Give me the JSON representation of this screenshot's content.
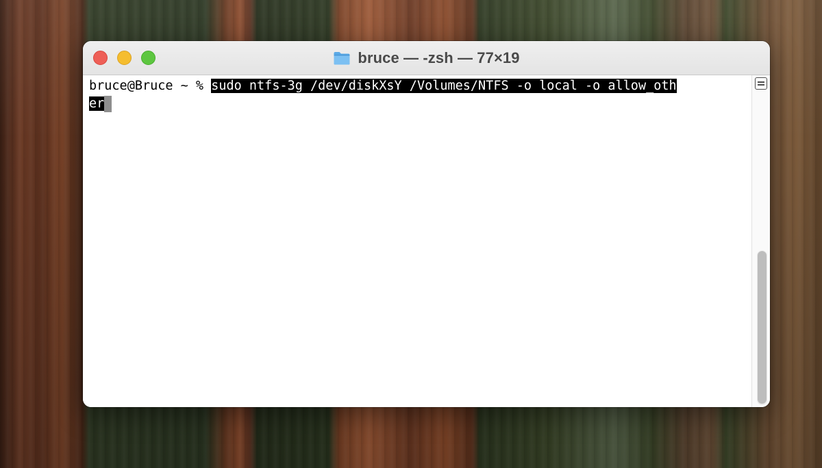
{
  "window": {
    "title": "bruce — -zsh — 77×19",
    "title_icon": "folder-icon"
  },
  "terminal": {
    "prompt": "bruce@Bruce ~ % ",
    "command_line1": "sudo ntfs-3g /dev/diskXsY /Volumes/NTFS -o local -o allow_oth",
    "command_line2": "er"
  },
  "colors": {
    "close": "#ee5f57",
    "minimize": "#f5bd2f",
    "maximize": "#5dc640",
    "selection": "#000000",
    "cursor": "#8e8e8e"
  }
}
